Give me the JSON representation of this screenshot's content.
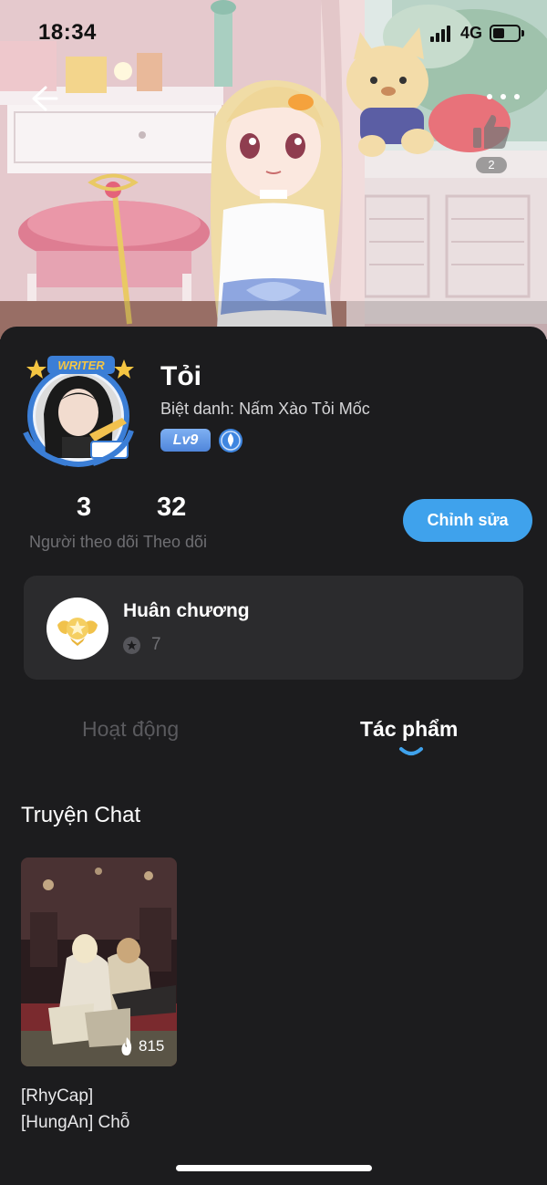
{
  "status_bar": {
    "time": "18:34",
    "network": "4G",
    "icons": [
      "signal-icon",
      "battery-icon"
    ]
  },
  "header": {
    "back_icon": "back-arrow-icon",
    "more_icon": "more-dots-icon",
    "like_icon": "thumbs-up-icon",
    "like_count": "2"
  },
  "profile": {
    "name": "Tỏi",
    "nickname": "Biệt danh: Nấm Xào Tỏi Mốc",
    "avatar_badge": "WRITER",
    "level": "Lv9",
    "verify_icon": "writer-badge-icon"
  },
  "stats": {
    "followers": {
      "value": "3",
      "label": "Người theo dõi"
    },
    "following": {
      "value": "32",
      "label": "Theo dõi"
    }
  },
  "edit_button": "Chỉnh sửa",
  "medals": {
    "title": "Huân chương",
    "count": "7",
    "icon": "medal-icon"
  },
  "tabs": [
    {
      "label": "Hoạt động",
      "active": false
    },
    {
      "label": "Tác phẩm",
      "active": true
    }
  ],
  "section": {
    "title": "Truyện Chat"
  },
  "stories": [
    {
      "title_line1": "[RhyCap]",
      "title_line2": "[HungAn] Chỗ",
      "views": "815",
      "views_icon": "flame-icon"
    }
  ],
  "colors": {
    "background": "#1c1c1e",
    "card": "#2b2b2d",
    "accent": "#3fa2ec",
    "muted_text": "#6f6f73"
  }
}
